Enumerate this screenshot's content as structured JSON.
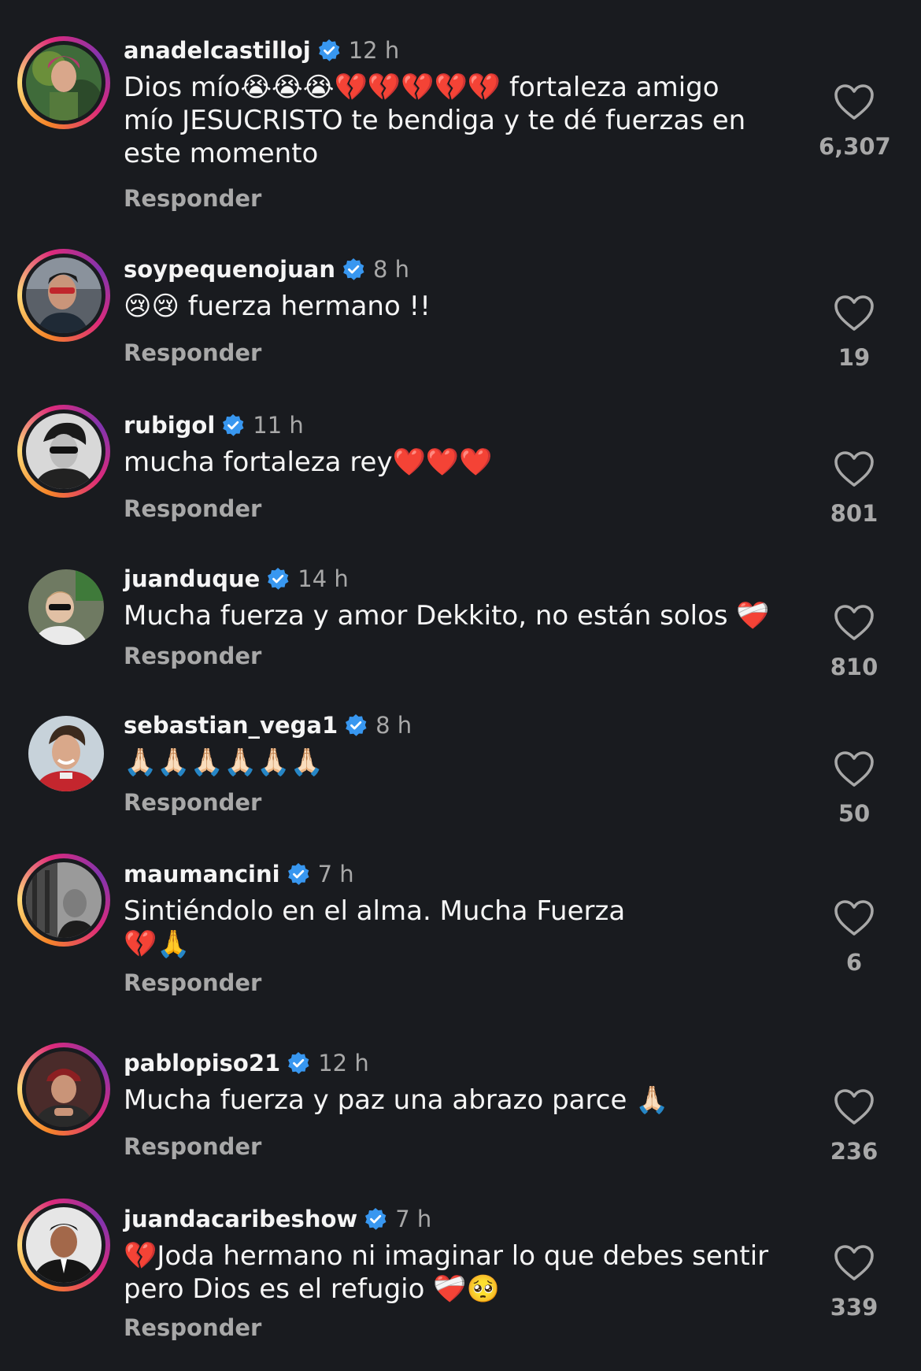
{
  "reply_label": "Responder",
  "comments": [
    {
      "username": "anadelcastilloj",
      "time": "12 h",
      "text": "Dios mío😭😭😭💔💔💔💔💔 fortaleza amigo mío JESUCRISTO te bendiga y te dé fuerzas en este momento",
      "likes": "6,307",
      "story_ring": true
    },
    {
      "username": "soypequenojuan",
      "time": "8 h",
      "text": "😢😢 fuerza hermano !!",
      "likes": "19",
      "story_ring": true
    },
    {
      "username": "rubigol",
      "time": "11 h",
      "text": "mucha fortaleza rey❤️❤️❤️",
      "likes": "801",
      "story_ring": true
    },
    {
      "username": "juanduque",
      "time": "14 h",
      "text": "Mucha fuerza y amor Dekkito, no están solos ❤️‍🩹",
      "likes": "810",
      "story_ring": false
    },
    {
      "username": "sebastian_vega1",
      "time": "8 h",
      "text": "🙏🏻🙏🏻🙏🏻🙏🏻🙏🏻🙏🏻",
      "likes": "50",
      "story_ring": false
    },
    {
      "username": "maumancini",
      "time": "7 h",
      "text": "Sintiéndolo en el alma. Mucha Fuerza 💔🙏",
      "likes": "6",
      "story_ring": true
    },
    {
      "username": "pablopiso21",
      "time": "12 h",
      "text": "Mucha fuerza y paz una abrazo parce 🙏🏻",
      "likes": "236",
      "story_ring": true
    },
    {
      "username": "juandacaribeshow",
      "time": "7 h",
      "text": "💔Joda hermano ni imaginar lo que debes sentir pero Dios es el refugio ❤️‍🩹🥺",
      "likes": "339",
      "story_ring": true
    }
  ],
  "colors": {
    "background": "#191b1f",
    "verified": "#3897f0",
    "secondary_text": "#a8a8a8"
  },
  "icons": {
    "verified": "verified-badge-icon",
    "like": "heart-outline-icon"
  }
}
